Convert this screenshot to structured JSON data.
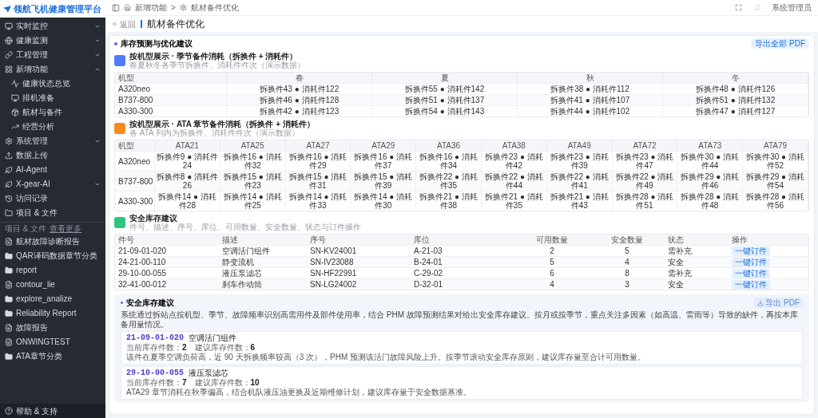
{
  "sidebar": {
    "logo": "领航飞机健康管理平台",
    "items": [
      {
        "label": "实时监控",
        "kind": "group",
        "expanded": false
      },
      {
        "label": "健康监测",
        "kind": "group",
        "expanded": false
      },
      {
        "label": "工程管理",
        "kind": "group",
        "expanded": false
      },
      {
        "label": "新增功能",
        "kind": "group",
        "expanded": true,
        "children": [
          {
            "label": "健康状态总览"
          },
          {
            "label": "排机准备"
          },
          {
            "label": "航材与备件"
          },
          {
            "label": "经营分析"
          }
        ]
      },
      {
        "label": "系统管理",
        "kind": "group",
        "expanded": false
      },
      {
        "label": "数据上传",
        "kind": "link"
      },
      {
        "label": "AI-Agent",
        "kind": "link"
      },
      {
        "label": "X-gear-AI",
        "kind": "group",
        "expanded": false
      },
      {
        "label": "访问记录",
        "kind": "link"
      },
      {
        "label": "项目 & 文件",
        "kind": "link"
      }
    ],
    "files_header": "项目 & 文件",
    "files_link": "查看更多",
    "files": [
      {
        "name": "航材故障诊断报告",
        "kind": "file"
      },
      {
        "name": "QAR译码数据章节分类",
        "kind": "folder"
      },
      {
        "name": "report",
        "kind": "folder"
      },
      {
        "name": "contour_lie",
        "kind": "file"
      },
      {
        "name": "explore_analize",
        "kind": "folder"
      },
      {
        "name": "Reliability Report",
        "kind": "folder"
      },
      {
        "name": "故障报告",
        "kind": "file"
      },
      {
        "name": "ONWINGTEST",
        "kind": "file"
      },
      {
        "name": "ATA章节分类",
        "kind": "folder"
      }
    ],
    "help": "帮助 & 支持"
  },
  "breadcrumb": [
    "新增功能",
    "航材备件优化"
  ],
  "breadcrumb_separator": ">",
  "user": "系统管理员",
  "back": "返回",
  "page_title": "航材备件优化",
  "card": {
    "title": "库存预测与优化建议",
    "badge": "导出全部 PDF",
    "seasonal": {
      "title": "按机型展示 · 季节备件消耗（拆换件 + 消耗件）",
      "subtitle": "春夏秋冬各季节拆换件、消耗件件次（演示数据）",
      "columns": [
        "机型",
        "春",
        "夏",
        "秋",
        "冬"
      ],
      "rows": [
        [
          "A320neo",
          "拆换件43 ● 消耗件122",
          "拆换件55 ● 消耗件142",
          "拆换件38 ● 消耗件112",
          "拆换件48 ● 消耗件126"
        ],
        [
          "B737-800",
          "拆换件46 ● 消耗件128",
          "拆换件51 ● 消耗件137",
          "拆换件41 ● 消耗件107",
          "拆换件51 ● 消耗件132"
        ],
        [
          "A330-300",
          "拆换件42 ● 消耗件123",
          "拆换件54 ● 消耗件143",
          "拆换件44 ● 消耗件102",
          "拆换件47 ● 消耗件127"
        ]
      ]
    },
    "ata": {
      "title": "按机型展示 · ATA 章节备件消耗（拆换件 + 消耗件）",
      "subtitle": "各 ATA 列内为拆换件、消耗件件次（演示数据）",
      "columns": [
        "机型",
        "ATA21",
        "ATA25",
        "ATA27",
        "ATA29",
        "ATA36",
        "ATA38",
        "ATA49",
        "ATA72",
        "ATA73",
        "ATA79"
      ],
      "rows": [
        [
          "A320neo",
          "拆换件9 ● 消耗件24",
          "拆换件16 ● 消耗件32",
          "拆换件16 ● 消耗件29",
          "拆换件16 ● 消耗件37",
          "拆换件16 ● 消耗件34",
          "拆换件23 ● 消耗件42",
          "拆换件23 ● 消耗件39",
          "拆换件23 ● 消耗件47",
          "拆换件30 ● 消耗件44",
          "拆换件30 ● 消耗件52"
        ],
        [
          "B737-800",
          "拆换件8 ● 消耗件26",
          "拆换件15 ● 消耗件23",
          "拆换件15 ● 消耗件31",
          "拆换件15 ● 消耗件39",
          "拆换件22 ● 消耗件35",
          "拆换件22 ● 消耗件44",
          "拆换件22 ● 消耗件41",
          "拆换件22 ● 消耗件49",
          "拆换件29 ● 消耗件46",
          "拆换件29 ● 消耗件54"
        ],
        [
          "A330-300",
          "拆换件14 ● 消耗件28",
          "拆换件14 ● 消耗件25",
          "拆换件14 ● 消耗件33",
          "拆换件14 ● 消耗件30",
          "拆换件21 ● 消耗件38",
          "拆换件21 ● 消耗件35",
          "拆换件21 ● 消耗件43",
          "拆换件28 ● 消耗件51",
          "拆换件28 ● 消耗件48",
          "拆换件28 ● 消耗件56"
        ]
      ]
    },
    "safety": {
      "title": "安全库存建议",
      "subtitle": "件号、描述、序号、库位、可用数量、安全数量、状态与订件操作",
      "columns": [
        "件号",
        "描述",
        "序号",
        "库位",
        "可用数量",
        "安全数量",
        "状态",
        "操作"
      ],
      "rows": [
        {
          "cells": [
            "21-09-01-020",
            "空调活门组件",
            "SN-KV24001",
            "A-21-03",
            "2",
            "5",
            "需补充"
          ],
          "action": "一键订件"
        },
        {
          "cells": [
            "24-21-00-110",
            "静变流机",
            "SN-IV23088",
            "B-24-01",
            "5",
            "4",
            "安全"
          ],
          "action": "一键订件"
        },
        {
          "cells": [
            "29-10-00-055",
            "液压泵滤芯",
            "SN-HF22991",
            "C-29-02",
            "6",
            "8",
            "需补充"
          ],
          "action": "一键订件"
        },
        {
          "cells": [
            "32-41-00-012",
            "刹车作动筒",
            "SN-LG24002",
            "D-32-01",
            "4",
            "3",
            "安全"
          ],
          "action": "一键订件"
        }
      ]
    },
    "advice": {
      "title": "安全库存建议",
      "export": "导出 PDF",
      "intro": "系统通过拆站点按机型、季节、故障频率识别高需用件及部件使用率，结合 PHM 故障预测结果对给出安全库存建议。按月或按季节，重点关注多因素（如高温、雷雨等）导致的缺件，再按本库备用量情况。",
      "items": [
        {
          "part": "21-09-01-020",
          "name": "空调活门组件",
          "current_label": "当前库存件数：",
          "current": "2",
          "suggest_label": "建议库存件数：",
          "suggest": "6",
          "note": "该件在夏季空调负荷高，近 90 天拆换频率较高（3 次），PHM 预测该活门故障风险上升。按季节滚动安全库存原则，建议库存量至合计可用数量。"
        },
        {
          "part": "29-10-00-055",
          "name": "液压泵滤芯",
          "current_label": "当前库存件数：",
          "current": "7",
          "suggest_label": "建议库存件数：",
          "suggest": "10",
          "note": "ATA29 章节消耗在秋季偏高，结合机队液压油更换及近期维修计划，建议库存量于安全数据基准。"
        }
      ]
    }
  }
}
